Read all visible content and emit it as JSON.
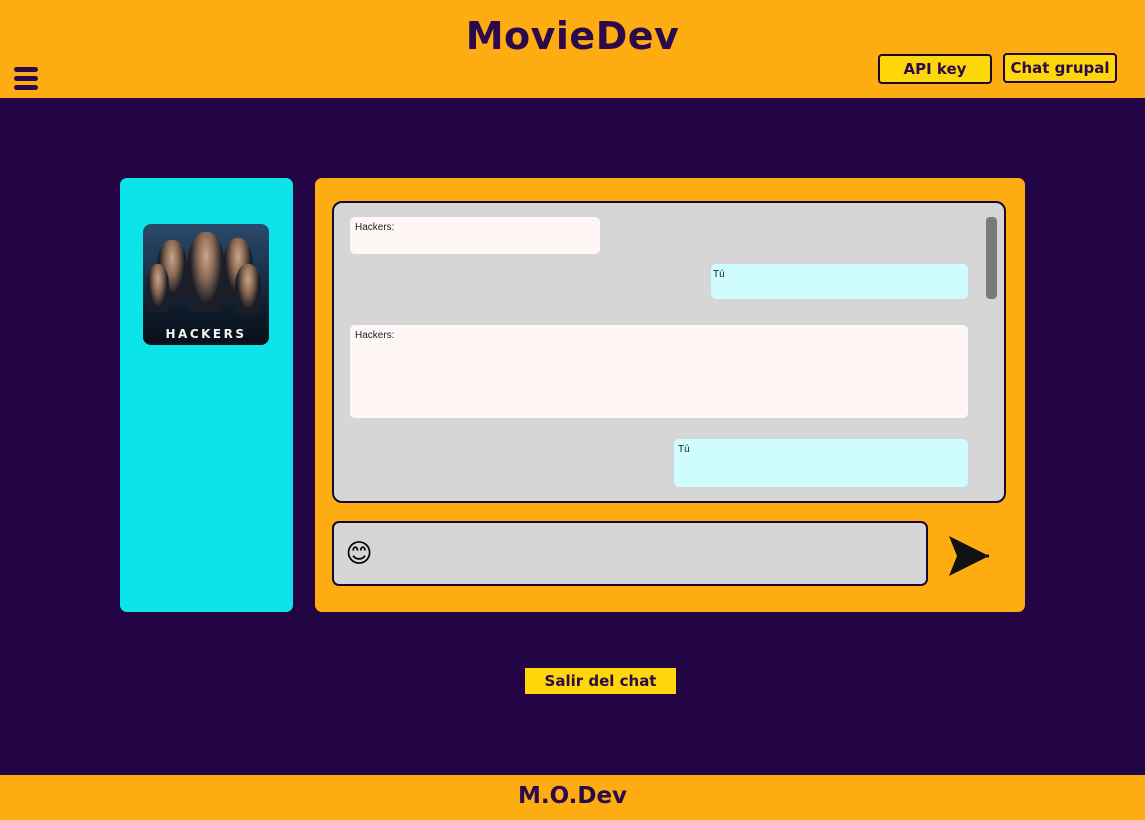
{
  "header": {
    "brand": "MovieDev",
    "api_key_label": "API key",
    "group_chat_label": "Chat grupal",
    "menu_icon": "hamburger-menu-icon"
  },
  "sidebar": {
    "poster_title": "HACKERS"
  },
  "chat": {
    "messages": [
      {
        "sender": "Hackers:",
        "text": ""
      },
      {
        "sender": "Tú",
        "text": ""
      },
      {
        "sender": "Hackers:",
        "text": ""
      },
      {
        "sender": "Tú",
        "text": ""
      }
    ],
    "input_value": "",
    "input_placeholder": "",
    "emoji_icon": "😊",
    "send_icon": "send-arrow-icon"
  },
  "exit_label": "Salir del chat",
  "footer": {
    "text": "M.O.Dev"
  },
  "colors": {
    "background": "#230444",
    "header_footer": "#FDAC12",
    "button_yellow": "#FDD70A",
    "sidebar": "#0CE4E9",
    "chat_area": "#D6D6D6",
    "bot_bubble": "#FFF7F6",
    "user_bubble": "#CFFDFD"
  }
}
